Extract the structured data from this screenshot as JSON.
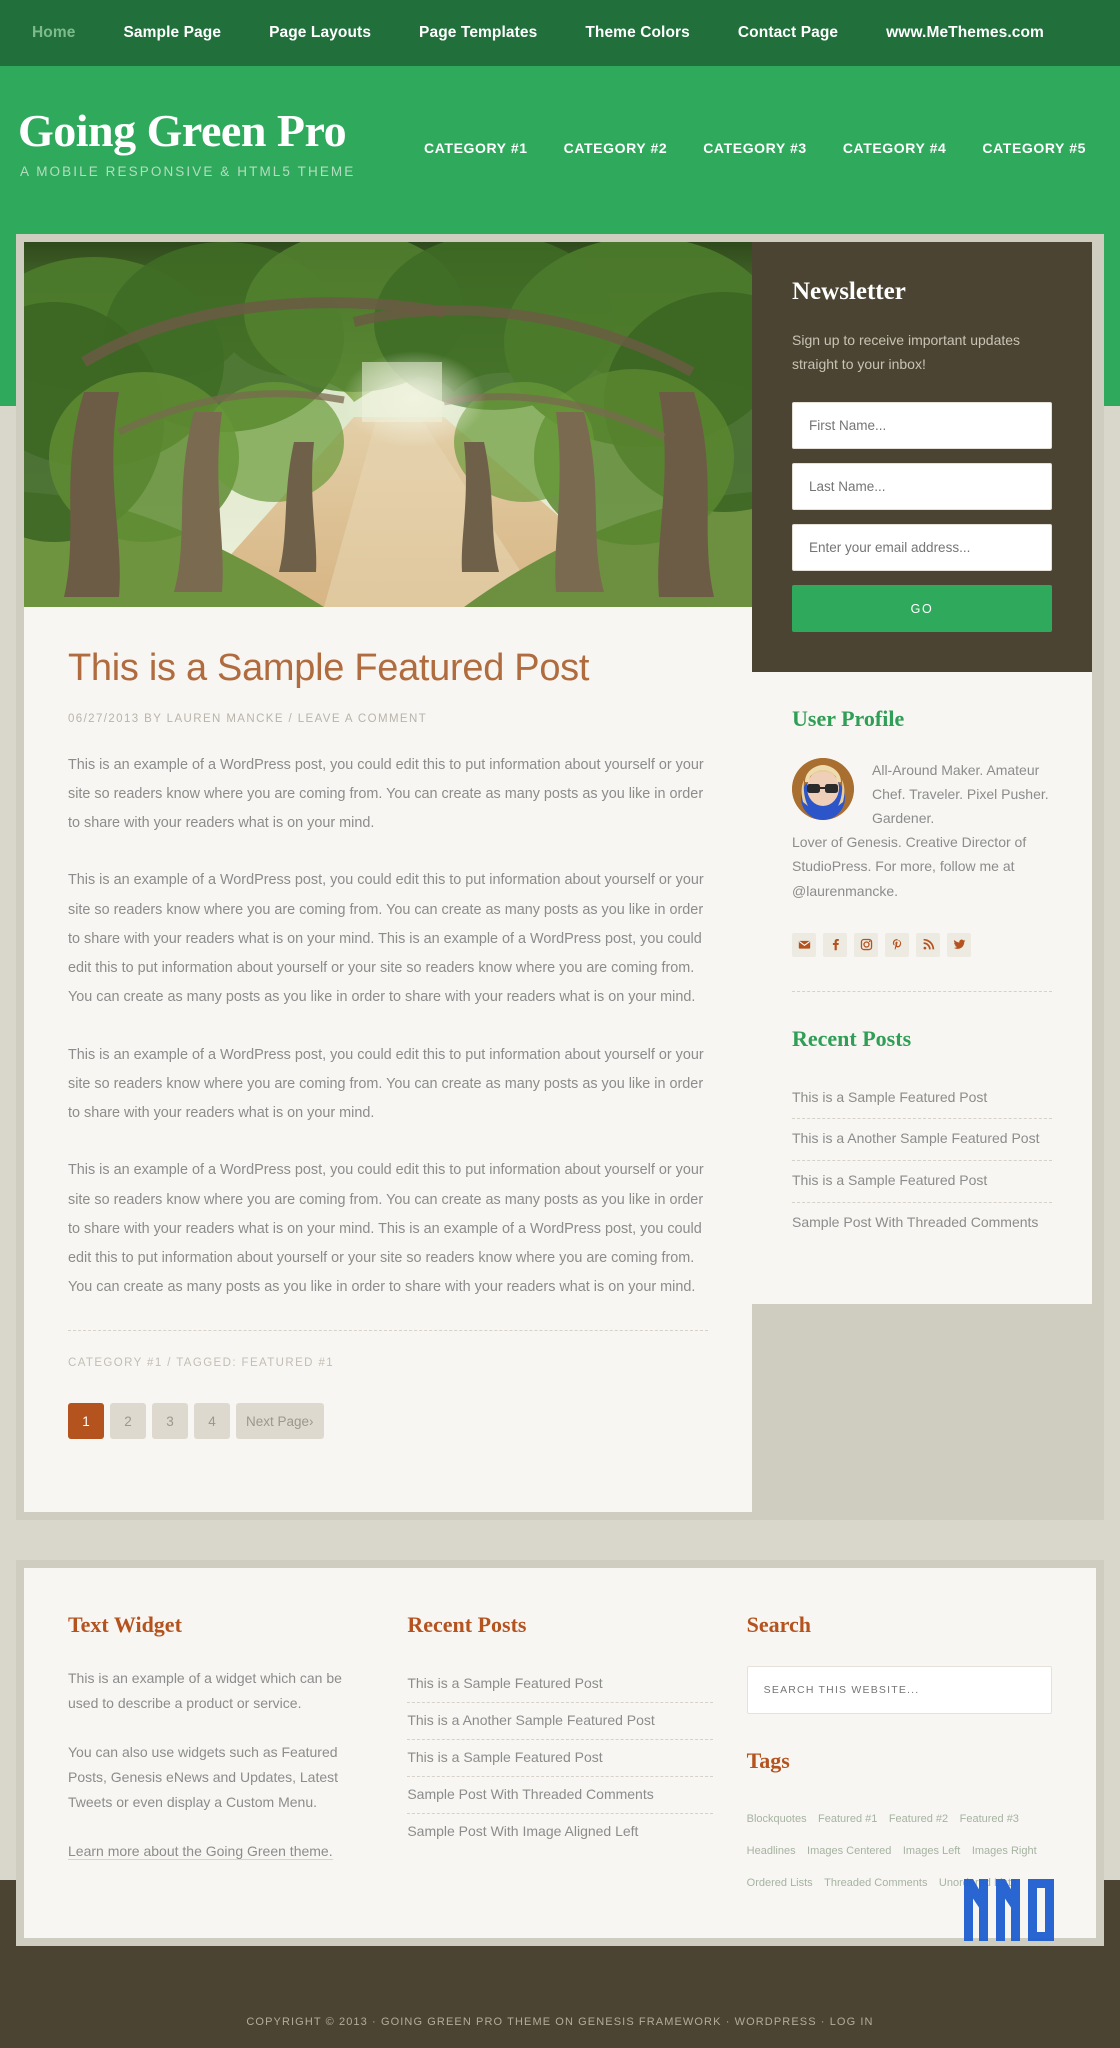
{
  "topnav": {
    "items": [
      {
        "label": "Home",
        "active": true
      },
      {
        "label": "Sample Page",
        "active": false
      },
      {
        "label": "Page Layouts",
        "active": false
      },
      {
        "label": "Page Templates",
        "active": false
      },
      {
        "label": "Theme Colors",
        "active": false
      },
      {
        "label": "Contact Page",
        "active": false
      },
      {
        "label": "www.MeThemes.com",
        "active": false
      }
    ]
  },
  "header": {
    "site_title": "Going Green Pro",
    "site_description": "A MOBILE RESPONSIVE & HTML5 THEME",
    "nav": [
      {
        "label": "CATEGORY #1"
      },
      {
        "label": "CATEGORY #2"
      },
      {
        "label": "CATEGORY #3"
      },
      {
        "label": "CATEGORY #4"
      },
      {
        "label": "CATEGORY #5"
      }
    ]
  },
  "post": {
    "title": "This is a Sample Featured Post",
    "meta": "06/27/2013 BY LAUREN MANCKE  /  LEAVE A COMMENT",
    "paragraphs": [
      "This is an example of a WordPress post, you could edit this to put information about yourself or your site so readers know where you are coming from. You can create as many posts as you like in order to share with your readers what is on your mind.",
      "This is an example of a WordPress post, you could edit this to put information about yourself or your site so readers know where you are coming from. You can create as many posts as you like in order to share with your readers what is on your mind. This is an example of a WordPress post, you could edit this to put information about yourself or your site so readers know where you are coming from. You can create as many posts as you like in order to share with your readers what is on your mind.",
      "This is an example of a WordPress post, you could edit this to put information about yourself or your site so readers know where you are coming from. You can create as many posts as you like in order to share with your readers what is on your mind.",
      "This is an example of a WordPress post, you could edit this to put information about yourself or your site so readers know where you are coming from. You can create as many posts as you like in order to share with your readers what is on your mind. This is an example of a WordPress post, you could edit this to put information about yourself or your site so readers know where you are coming from. You can create as many posts as you like in order to share with your readers what is on your mind."
    ],
    "footer_meta": "CATEGORY #1  /  TAGGED: FEATURED #1"
  },
  "pagination": {
    "pages": [
      "1",
      "2",
      "3",
      "4"
    ],
    "active": "1",
    "next_label": "Next Page›"
  },
  "newsletter": {
    "title": "Newsletter",
    "description": "Sign up to receive important updates straight to your inbox!",
    "first_name_placeholder": "First Name...",
    "last_name_placeholder": "Last Name...",
    "email_placeholder": "Enter your email address...",
    "submit_label": "GO",
    "submit_color": "#2faa5d"
  },
  "user_profile": {
    "title": "User Profile",
    "bio_indent": "All-Around Maker. Amateur Chef. Traveler. Pixel Pusher. Gardener.",
    "bio_rest": "Lover of Genesis. Creative Director of StudioPress. For more, follow me at @laurenmancke.",
    "social": [
      {
        "name": "email-icon"
      },
      {
        "name": "facebook-icon"
      },
      {
        "name": "instagram-icon"
      },
      {
        "name": "pinterest-icon"
      },
      {
        "name": "rss-icon"
      },
      {
        "name": "twitter-icon"
      }
    ]
  },
  "sidebar_recent": {
    "title": "Recent Posts",
    "items": [
      "This is a Sample Featured Post",
      "This is a Another Sample Featured Post",
      "This is a Sample Featured Post",
      "Sample Post With Threaded Comments"
    ]
  },
  "footer_widgets": {
    "text_widget": {
      "title": "Text Widget",
      "p1": "This is an example of a widget which can be used to describe a product or service.",
      "p2": "You can also use widgets such as Featured Posts, Genesis eNews and Updates, Latest Tweets or even display a Custom Menu.",
      "p3_link": "Learn more about the Going Green theme."
    },
    "recent_posts": {
      "title": "Recent Posts",
      "items": [
        "This is a Sample Featured Post",
        "This is a Another Sample Featured Post",
        "This is a Sample Featured Post",
        "Sample Post With Threaded Comments",
        "Sample Post With Image Aligned Left"
      ]
    },
    "search": {
      "title": "Search",
      "placeholder": "SEARCH THIS WEBSITE..."
    },
    "tags": {
      "title": "Tags",
      "items": [
        "Blockquotes",
        "Featured #1",
        "Featured #2",
        "Featured #3",
        "Headlines",
        "Images Centered",
        "Images Left",
        "Images Right",
        "Ordered Lists",
        "Threaded Comments",
        "Unordered Lists"
      ]
    }
  },
  "site_footer": {
    "credits": "COPYRIGHT © 2013 · GOING GREEN PRO THEME ON GENESIS FRAMEWORK · WORDPRESS · LOG IN"
  },
  "colors": {
    "green_dark": "#21703b",
    "green": "#2faa5d",
    "brown_dark": "#4b4433",
    "accent_orange": "#b5531f",
    "title_brown": "#b06c3f"
  }
}
